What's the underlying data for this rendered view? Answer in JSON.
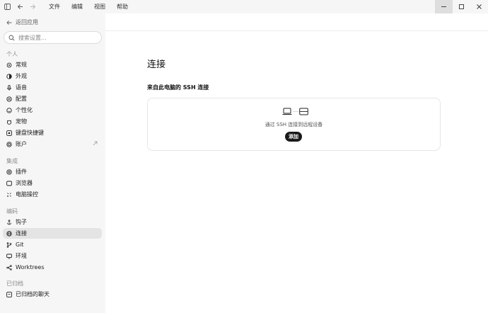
{
  "titlebar": {
    "menu": [
      "文件",
      "编辑",
      "视图",
      "帮助"
    ],
    "icons": [
      "sidebar-toggle-icon",
      "back-arrow-icon",
      "forward-arrow-icon"
    ],
    "window_controls": [
      "minimize-icon",
      "maximize-icon",
      "close-icon"
    ]
  },
  "sidebar": {
    "back_label": "返回应用",
    "search_placeholder": "搜索设置...",
    "groups": [
      {
        "label": "个人",
        "items": [
          {
            "label": "常规",
            "icon": "gear-icon"
          },
          {
            "label": "外观",
            "icon": "palette-icon"
          },
          {
            "label": "语音",
            "icon": "mic-icon"
          },
          {
            "label": "配置",
            "icon": "sliders-icon"
          },
          {
            "label": "个性化",
            "icon": "smiley-icon"
          },
          {
            "label": "宠物",
            "icon": "pet-icon"
          },
          {
            "label": "键盘快捷键",
            "icon": "keyboard-icon"
          },
          {
            "label": "账户",
            "icon": "account-icon",
            "external": true
          }
        ]
      },
      {
        "label": "集成",
        "items": [
          {
            "label": "插件",
            "icon": "plugin-icon"
          },
          {
            "label": "浏览器",
            "icon": "browser-icon"
          },
          {
            "label": "电脑操控",
            "icon": "computer-control-icon"
          }
        ]
      },
      {
        "label": "编码",
        "items": [
          {
            "label": "钩子",
            "icon": "hook-icon"
          },
          {
            "label": "连接",
            "icon": "globe-icon",
            "selected": true
          },
          {
            "label": "Git",
            "icon": "git-branch-icon"
          },
          {
            "label": "环境",
            "icon": "monitor-icon"
          },
          {
            "label": "Worktrees",
            "icon": "worktree-icon"
          }
        ]
      },
      {
        "label": "已归档",
        "items": [
          {
            "label": "已归档的聊天",
            "icon": "archive-icon"
          }
        ]
      }
    ]
  },
  "main": {
    "title": "连接",
    "section_title": "来自此电脑的 SSH 连接",
    "card": {
      "description": "通过 SSH 连接到远程设备",
      "add_label": "添加",
      "icons": [
        "laptop-icon",
        "server-icon"
      ]
    }
  },
  "colors": {
    "sidebar_bg": "#f6f6f6",
    "selected_bg": "#e4e4e4",
    "button_bg": "#1a1a1a"
  }
}
